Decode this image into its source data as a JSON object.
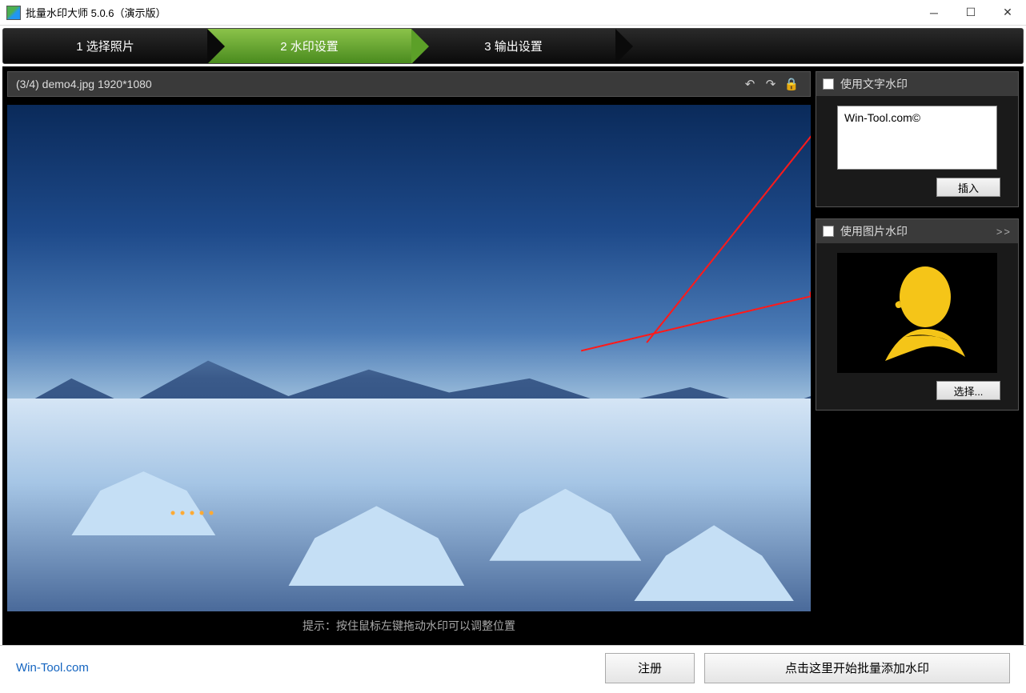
{
  "window": {
    "title": "批量水印大师 5.0.6（演示版）"
  },
  "steps": {
    "s1": "1 选择照片",
    "s2": "2 水印设置",
    "s3": "3 输出设置"
  },
  "preview": {
    "counter": "(3/4) demo4.jpg 1920*1080",
    "hint": "提示：按住鼠标左键拖动水印可以调整位置"
  },
  "textWatermark": {
    "label": "使用文字水印",
    "value": "Win-Tool.com©",
    "insertBtn": "插入"
  },
  "imageWatermark": {
    "label": "使用图片水印",
    "more": ">>",
    "selectBtn": "选择..."
  },
  "bottom": {
    "link": "Win-Tool.com",
    "register": "注册",
    "start": "点击这里开始批量添加水印"
  }
}
